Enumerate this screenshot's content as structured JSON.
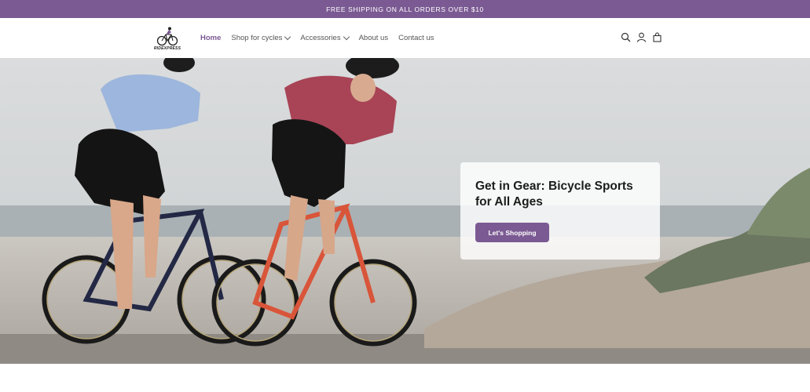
{
  "announcement": "FREE SHIPPING ON ALL ORDERS OVER $10",
  "brand": {
    "logo_text": "RIDEXPRESS",
    "logo_icon": "cyclist-icon"
  },
  "nav": {
    "items": [
      {
        "label": "Home",
        "active": true,
        "dropdown": false
      },
      {
        "label": "Shop for cycles",
        "active": false,
        "dropdown": true
      },
      {
        "label": "Accessories",
        "active": false,
        "dropdown": true
      },
      {
        "label": "About us",
        "active": false,
        "dropdown": false
      },
      {
        "label": "Contact us",
        "active": false,
        "dropdown": false
      }
    ]
  },
  "header_icons": [
    "search-icon",
    "account-icon",
    "cart-icon"
  ],
  "hero": {
    "image": "two-cyclists-on-road-bikes-at-beach",
    "title": "Get in Gear: Bicycle Sports for All Ages",
    "cta_label": "Let's Shopping"
  },
  "colors": {
    "accent": "#7b5a93",
    "text": "#1c1c1c"
  }
}
